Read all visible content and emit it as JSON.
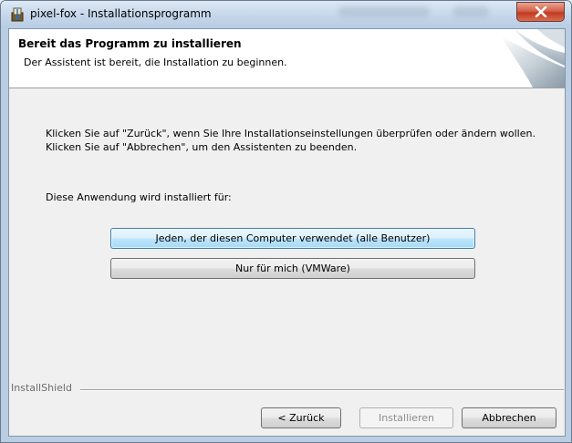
{
  "window": {
    "title": "pixel-fox - Installationsprogramm"
  },
  "header": {
    "title": "Bereit das Programm zu installieren",
    "subtitle": "Der Assistent ist bereit, die Installation zu beginnen."
  },
  "body": {
    "instructions": "Klicken Sie auf \"Zurück\", wenn Sie Ihre Installationseinstellungen überprüfen oder ändern wollen. Klicken Sie auf \"Abbrechen\", um den Assistenten zu beenden.",
    "install_for_label": "Diese Anwendung wird installiert für:"
  },
  "options": {
    "all_users": "Jeden, der diesen Computer verwendet (alle Benutzer)",
    "only_me": "Nur für mich (VMWare)"
  },
  "footer": {
    "brand": "InstallShield",
    "back_label": "< Zurück",
    "install_label": "Installieren",
    "cancel_label": "Abbrechen"
  },
  "colors": {
    "focus_border": "#3c7fb1",
    "close_button": "#c23a22"
  }
}
